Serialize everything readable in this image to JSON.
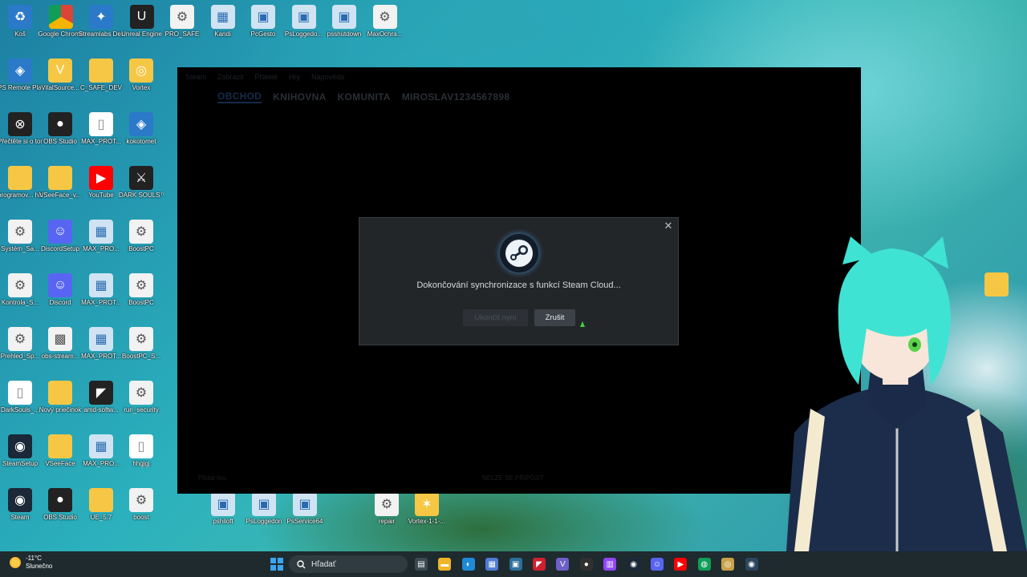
{
  "desktop": {
    "icons": [
      {
        "label": "Koš",
        "glyph": "♻",
        "style": "blueic",
        "name": "recycle-bin-icon"
      },
      {
        "label": "Google Chrome",
        "glyph": "",
        "style": "chromeic",
        "name": "chrome-icon"
      },
      {
        "label": "Streamlabs Desktop",
        "glyph": "✦",
        "style": "blueic",
        "name": "streamlabs-icon"
      },
      {
        "label": "Unreal Engine",
        "glyph": "U",
        "style": "obs",
        "name": "unreal-icon"
      },
      {
        "label": "PRO_SAFE",
        "glyph": "⚙",
        "style": "gear",
        "name": "gear-icon"
      },
      {
        "label": "Kandi",
        "glyph": "▦",
        "style": "img",
        "name": "image-icon"
      },
      {
        "label": "PcGesto",
        "glyph": "▣",
        "style": "img",
        "name": "window-icon"
      },
      {
        "label": "PsLoggedo...",
        "glyph": "▣",
        "style": "img",
        "name": "window-icon"
      },
      {
        "label": "psshutdown",
        "glyph": "▣",
        "style": "img",
        "name": "window-icon"
      },
      {
        "label": "MaxOchra...",
        "glyph": "⚙",
        "style": "gear",
        "name": "gear-icon"
      },
      {
        "label": "PS Remote Play",
        "glyph": "◈",
        "style": "blueic",
        "name": "remote-play-icon"
      },
      {
        "label": "VitalSource...",
        "glyph": "V",
        "style": "folder",
        "name": "vitalsource-icon"
      },
      {
        "label": "C_SAFE_DEV",
        "glyph": "",
        "style": "folder",
        "name": "folder-icon"
      },
      {
        "label": "Vortex",
        "glyph": "◎",
        "style": "folder",
        "name": "vortex-icon"
      },
      {
        "label": "Přečtěte si o tomto",
        "glyph": "⊗",
        "style": "obs",
        "name": "app-icon"
      },
      {
        "label": "OBS Studio",
        "glyph": "●",
        "style": "obs",
        "name": "obs-icon"
      },
      {
        "label": "MAX_PROT...",
        "glyph": "▯",
        "style": "doc",
        "name": "document-icon"
      },
      {
        "label": "kokotomet",
        "glyph": "◈",
        "style": "blueic",
        "name": "app-icon"
      },
      {
        "label": "programov... hitr",
        "glyph": "",
        "style": "folder",
        "name": "folder-icon"
      },
      {
        "label": "VSeeFace_v...",
        "glyph": "",
        "style": "folder",
        "name": "folder-icon"
      },
      {
        "label": "YouTube",
        "glyph": "▶",
        "style": "yt",
        "name": "youtube-icon"
      },
      {
        "label": "DARK SOULS™ II",
        "glyph": "⚔",
        "style": "obs",
        "name": "game-icon"
      },
      {
        "label": "Systém_Sa...",
        "glyph": "⚙",
        "style": "gear",
        "name": "gear-icon"
      },
      {
        "label": "DiscordSetup",
        "glyph": "☺",
        "style": "disc",
        "name": "discord-icon"
      },
      {
        "label": "MAX_PRO...",
        "glyph": "▦",
        "style": "img",
        "name": "image-icon"
      },
      {
        "label": "BoostPC",
        "glyph": "⚙",
        "style": "gear",
        "name": "gear-icon"
      },
      {
        "label": "Kontrola_S...",
        "glyph": "⚙",
        "style": "gear",
        "name": "gear-icon"
      },
      {
        "label": "Discord",
        "glyph": "☺",
        "style": "disc",
        "name": "discord-icon"
      },
      {
        "label": "MAX_PROT...",
        "glyph": "▦",
        "style": "img",
        "name": "image-icon"
      },
      {
        "label": "BoostPC",
        "glyph": "⚙",
        "style": "gear",
        "name": "gear-icon"
      },
      {
        "label": "Prehled_Sp...",
        "glyph": "⚙",
        "style": "gear",
        "name": "gear-icon"
      },
      {
        "label": "obs-stream...",
        "glyph": "▩",
        "style": "gear",
        "name": "app-icon"
      },
      {
        "label": "MAX_PROT...",
        "glyph": "▦",
        "style": "img",
        "name": "image-icon"
      },
      {
        "label": "BoostPC_S...",
        "glyph": "⚙",
        "style": "gear",
        "name": "gear-icon"
      },
      {
        "label": "DarkSouls_...",
        "glyph": "▯",
        "style": "doc",
        "name": "document-icon"
      },
      {
        "label": "Nový priečinok",
        "glyph": "",
        "style": "folder",
        "name": "folder-icon"
      },
      {
        "label": "amd-softw...",
        "glyph": "◤",
        "style": "obs",
        "name": "amd-icon"
      },
      {
        "label": "run_security",
        "glyph": "⚙",
        "style": "gear",
        "name": "gear-icon"
      },
      {
        "label": "SteamSetup",
        "glyph": "◉",
        "style": "steamic",
        "name": "steam-icon"
      },
      {
        "label": "VSeeFace",
        "glyph": "",
        "style": "folder",
        "name": "folder-icon"
      },
      {
        "label": "MAX_PRO...",
        "glyph": "▦",
        "style": "img",
        "name": "image-icon"
      },
      {
        "label": "hhgjgj",
        "glyph": "▯",
        "style": "doc",
        "name": "document-icon"
      },
      {
        "label": "Steam",
        "glyph": "◉",
        "style": "steamic",
        "name": "steam-icon"
      },
      {
        "label": "OBS Studio",
        "glyph": "●",
        "style": "obs",
        "name": "obs-icon"
      },
      {
        "label": "UE_5.7",
        "glyph": "",
        "style": "folder",
        "name": "folder-icon"
      },
      {
        "label": "boost",
        "glyph": "⚙",
        "style": "gear",
        "name": "gear-icon"
      }
    ],
    "bottom_icons": [
      {
        "label": "pshiloft",
        "glyph": "▣",
        "style": "img",
        "name": "window-icon"
      },
      {
        "label": "PsLoggedon",
        "glyph": "▣",
        "style": "img",
        "name": "window-icon"
      },
      {
        "label": "PsService64",
        "glyph": "▣",
        "style": "img",
        "name": "window-icon"
      },
      {
        "label": "repair",
        "glyph": "⚙",
        "style": "gear",
        "name": "gear-icon"
      },
      {
        "label": "Vortex-1-1-...",
        "glyph": "✶",
        "style": "folder",
        "name": "vortex-icon"
      }
    ],
    "right_folder": {
      "label": "",
      "name": "folder-icon"
    }
  },
  "steam": {
    "menu": [
      "Steam",
      "Zobrazit",
      "Přátelé",
      "Hry",
      "Nápověda"
    ],
    "nav": {
      "store": "OBCHOD",
      "library": "KNIHOVNA",
      "community": "KOMUNITA",
      "profile": "MIROSLAV1234567898"
    },
    "bottom_left": "Přidat hru",
    "bottom_center": "NELZE SE PŘIPOJIT"
  },
  "dialog": {
    "message": "Dokončování synchronizace s funkcí Steam Cloud...",
    "disabled_button": "Ukončit nyní",
    "cancel_button": "Zrušit",
    "close_glyph": "✕"
  },
  "taskbar": {
    "weather_temp": "-11°C",
    "weather_desc": "Slunečno",
    "search_placeholder": "Hľadať",
    "apps": [
      {
        "name": "task-view-icon",
        "glyph": "▤",
        "color": "#3a4a52"
      },
      {
        "name": "file-explorer-icon",
        "glyph": "▬",
        "color": "#f0b429"
      },
      {
        "name": "edge-icon",
        "glyph": "◐",
        "color": "#1f8ad6"
      },
      {
        "name": "store-icon",
        "glyph": "▦",
        "color": "#4f7cd6"
      },
      {
        "name": "app-icon",
        "glyph": "▣",
        "color": "#2b6f9a"
      },
      {
        "name": "amd-icon",
        "glyph": "◤",
        "color": "#d0202e"
      },
      {
        "name": "vitalsource-icon",
        "glyph": "V",
        "color": "#6f5fc8"
      },
      {
        "name": "obs-icon",
        "glyph": "●",
        "color": "#303030"
      },
      {
        "name": "twitch-icon",
        "glyph": "▥",
        "color": "#9146ff"
      },
      {
        "name": "steam-icon",
        "glyph": "◉",
        "color": "#1b2838"
      },
      {
        "name": "discord-icon",
        "glyph": "☺",
        "color": "#5865f2"
      },
      {
        "name": "youtube-icon",
        "glyph": "▶",
        "color": "#ff0000"
      },
      {
        "name": "chrome-icon",
        "glyph": "◍",
        "color": "#0f9d58"
      },
      {
        "name": "vortex-icon",
        "glyph": "◎",
        "color": "#c9a14a"
      },
      {
        "name": "steam-active-icon",
        "glyph": "◉",
        "color": "#2a475e"
      }
    ]
  }
}
